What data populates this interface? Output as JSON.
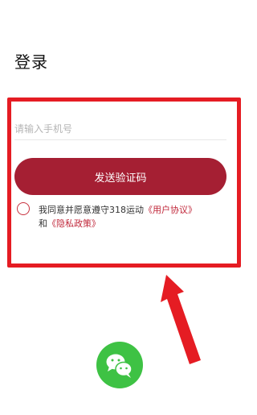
{
  "page": {
    "title": "登录"
  },
  "login_form": {
    "phone_placeholder": "请输入手机号",
    "send_code_label": "发送验证码",
    "agreement": {
      "prefix": "我同意并愿意遵守318运动",
      "user_agreement_link": "《用户协议》",
      "conjunction": "和",
      "privacy_policy_link": "《隐私政策》"
    }
  },
  "third_party_login": {
    "wechat_icon": "wechat-icon"
  },
  "annotation": {
    "highlight_color": "#e51c23",
    "arrow_color": "#e51c23"
  },
  "colors": {
    "primary_button": "#a51f33",
    "link": "#c0273a",
    "wechat_green": "#3ec244"
  }
}
